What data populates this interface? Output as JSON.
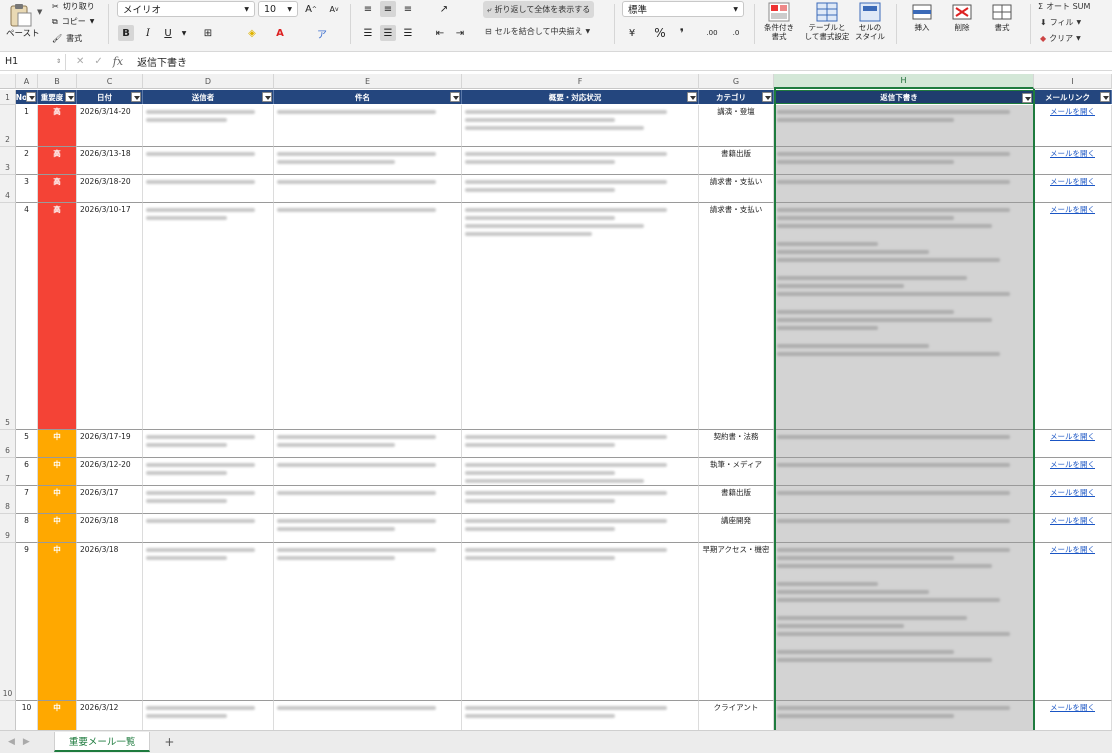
{
  "ribbon": {
    "paste": "ペースト",
    "cut": "切り取り",
    "copy": "コピー",
    "format_painter": "書式",
    "font_name": "メイリオ",
    "font_size": "10",
    "grow_font": "A",
    "shrink_font": "A",
    "bold": "B",
    "italic": "I",
    "underline": "U",
    "wrap_text": "折り返して全体を表示する",
    "merge_center": "セルを結合して中央揃え",
    "number_format": "標準",
    "percent": "%",
    "comma": "❜",
    "conditional_format": "条件付き\n書式",
    "table_format": "テーブルと\nして書式設定",
    "cell_style": "セルの\nスタイル",
    "insert": "挿入",
    "delete": "削除",
    "format": "書式",
    "autosum": "オート SUM",
    "fill": "フィル",
    "clear": "クリア"
  },
  "formula_bar": {
    "name_box": "H1",
    "fx": "fx",
    "value": "返信下書き"
  },
  "columns": [
    "A",
    "B",
    "C",
    "D",
    "E",
    "F",
    "G",
    "H",
    "I"
  ],
  "table_headers": {
    "no": "No",
    "priority": "重要度",
    "date": "日付",
    "sender": "送信者",
    "subject": "件名",
    "summary": "概要・対応状況",
    "category": "カテゴリ",
    "reply_draft": "返信下書き",
    "mail_link": "メールリンク"
  },
  "rows": [
    {
      "row": "2",
      "no": "1",
      "priority": "高",
      "date": "2026/3/14-20",
      "category": "講演・登壇",
      "link": "メールを開く",
      "color": "#f44336",
      "lines": {
        "d": 2,
        "e": 1,
        "f": 3,
        "h": 2
      }
    },
    {
      "row": "3",
      "no": "2",
      "priority": "高",
      "date": "2026/3/13-18",
      "category": "書籍出版",
      "link": "メールを開く",
      "color": "#f44336",
      "lines": {
        "d": 1,
        "e": 2,
        "f": 2,
        "h": 2
      }
    },
    {
      "row": "4",
      "no": "3",
      "priority": "高",
      "date": "2026/3/18-20",
      "category": "請求書・支払い",
      "link": "メールを開く",
      "color": "#f44336",
      "lines": {
        "d": 1,
        "e": 1,
        "f": 2,
        "h": 1
      }
    },
    {
      "row": "5",
      "no": "4",
      "priority": "高",
      "date": "2026/3/10-17",
      "category": "請求書・支払い",
      "link": "メールを開く",
      "color": "#f44336",
      "lines": {
        "d": 2,
        "e": 1,
        "f": 4,
        "h": 14
      }
    },
    {
      "row": "6",
      "no": "5",
      "priority": "中",
      "date": "2026/3/17-19",
      "category": "契約書・法務",
      "link": "メールを開く",
      "color": "#ffa800",
      "lines": {
        "d": 2,
        "e": 2,
        "f": 2,
        "h": 1
      }
    },
    {
      "row": "7",
      "no": "6",
      "priority": "中",
      "date": "2026/3/12-20",
      "category": "執筆・メディア",
      "link": "メールを開く",
      "color": "#ffa800",
      "lines": {
        "d": 2,
        "e": 1,
        "f": 3,
        "h": 1
      }
    },
    {
      "row": "8",
      "no": "7",
      "priority": "中",
      "date": "2026/3/17",
      "category": "書籍出版",
      "link": "メールを開く",
      "color": "#ffa800",
      "lines": {
        "d": 2,
        "e": 1,
        "f": 2,
        "h": 1
      }
    },
    {
      "row": "9",
      "no": "8",
      "priority": "中",
      "date": "2026/3/18",
      "category": "講座開発",
      "link": "メールを開く",
      "color": "#ffa800",
      "lines": {
        "d": 1,
        "e": 2,
        "f": 2,
        "h": 1
      }
    },
    {
      "row": "10",
      "no": "9",
      "priority": "中",
      "date": "2026/3/18",
      "category": "早期アクセス・機密",
      "link": "メールを開く",
      "color": "#ffa800",
      "lines": {
        "d": 2,
        "e": 2,
        "f": 2,
        "h": 11
      }
    },
    {
      "row": "",
      "no": "10",
      "priority": "中",
      "date": "2026/3/12",
      "category": "クライアント",
      "link": "メールを開く",
      "color": "#ffa800",
      "lines": {
        "d": 2,
        "e": 1,
        "f": 2,
        "h": 2
      }
    }
  ],
  "sheet_tab": "重要メール一覧",
  "add_sheet": "+",
  "colors": {
    "header_blue": "#24467e",
    "priority_high": "#f44336",
    "priority_mid": "#ffa800",
    "selection_green": "#1e7b3e",
    "link_blue": "#1a55c4"
  }
}
